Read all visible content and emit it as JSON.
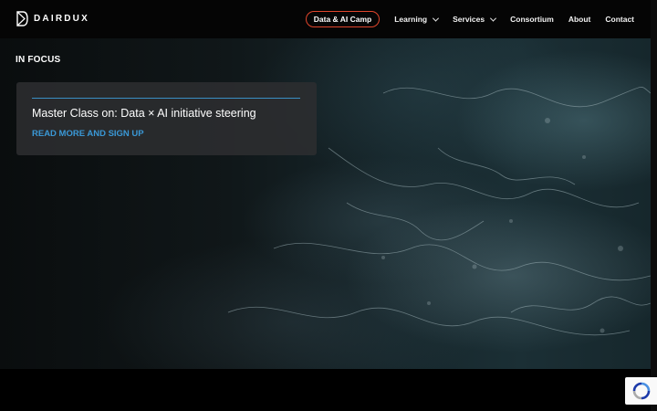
{
  "brand": {
    "name": "DAIRDUX",
    "icon": "dairdux-logo-icon"
  },
  "nav": {
    "pill_label": "Data & AI Camp",
    "pill_color": "#e0452c",
    "items": [
      {
        "label": "Learning",
        "has_dropdown": true
      },
      {
        "label": "Services",
        "has_dropdown": true
      },
      {
        "label": "Consortium",
        "has_dropdown": false
      },
      {
        "label": "About",
        "has_dropdown": false
      },
      {
        "label": "Contact",
        "has_dropdown": false
      }
    ]
  },
  "hero": {
    "section_label": "IN FOCUS",
    "card": {
      "title": "Master Class on: Data × AI initiative steering",
      "link_label": "READ MORE AND SIGN UP",
      "accent_color": "#3a8fc4"
    }
  },
  "recaptcha": {
    "icon": "recaptcha-icon"
  }
}
